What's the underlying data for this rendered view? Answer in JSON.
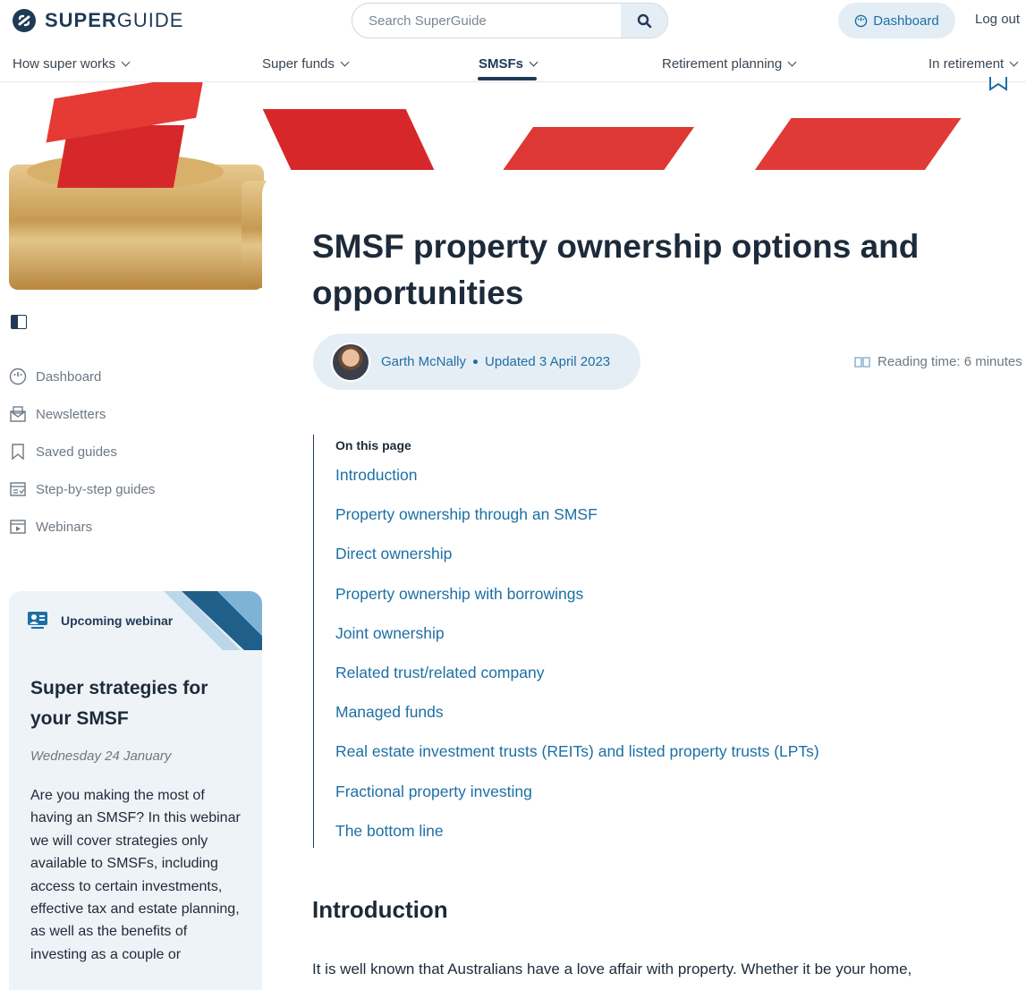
{
  "header": {
    "logo_bold": "SUPER",
    "logo_light": "GUIDE",
    "search_placeholder": "Search SuperGuide",
    "dashboard_label": "Dashboard",
    "logout_label": "Log out"
  },
  "nav": {
    "items": [
      {
        "label": "How super works"
      },
      {
        "label": "Super funds"
      },
      {
        "label": "SMSFs"
      },
      {
        "label": "Retirement planning"
      },
      {
        "label": "In retirement"
      }
    ],
    "active": "SMSFs"
  },
  "article": {
    "title": "SMSF property ownership options and opportunities",
    "author": "Garth McNally",
    "updated": "Updated 3 April 2023",
    "reading_time": "Reading time: 6 minutes",
    "toc_heading": "On this page",
    "toc": [
      "Introduction",
      "Property ownership through an SMSF",
      "Direct ownership",
      "Property ownership with borrowings",
      "Joint ownership",
      "Related trust/related company",
      "Managed funds",
      "Real estate investment trusts (REITs) and listed property trusts (LPTs)",
      "Fractional property investing",
      "The bottom line"
    ],
    "intro_heading": "Introduction",
    "intro_text": "It is well known that Australians have a love affair with property. Whether it be your home,"
  },
  "sidebar": {
    "items": [
      {
        "label": "Dashboard",
        "icon": "dashboard-icon"
      },
      {
        "label": "Newsletters",
        "icon": "newsletter-icon"
      },
      {
        "label": "Saved guides",
        "icon": "bookmark-icon"
      },
      {
        "label": "Step-by-step guides",
        "icon": "guides-icon"
      },
      {
        "label": "Webinars",
        "icon": "webinar-icon"
      }
    ]
  },
  "webinar": {
    "tag": "Upcoming webinar",
    "title": "Super strategies for your SMSF",
    "date": "Wednesday 24 January",
    "body": "Are you making the most of having an SMSF? In this webinar we will cover strategies only available to SMSFs, including access to certain investments, effective tax and estate planning, as well as the benefits of investing as a couple or"
  },
  "colors": {
    "brand_navy": "#1f3a56",
    "link_blue": "#1d6fa5",
    "pill_bg": "#e6eef5",
    "card_bg": "#eef3f7",
    "house_red": "#d6282a"
  }
}
